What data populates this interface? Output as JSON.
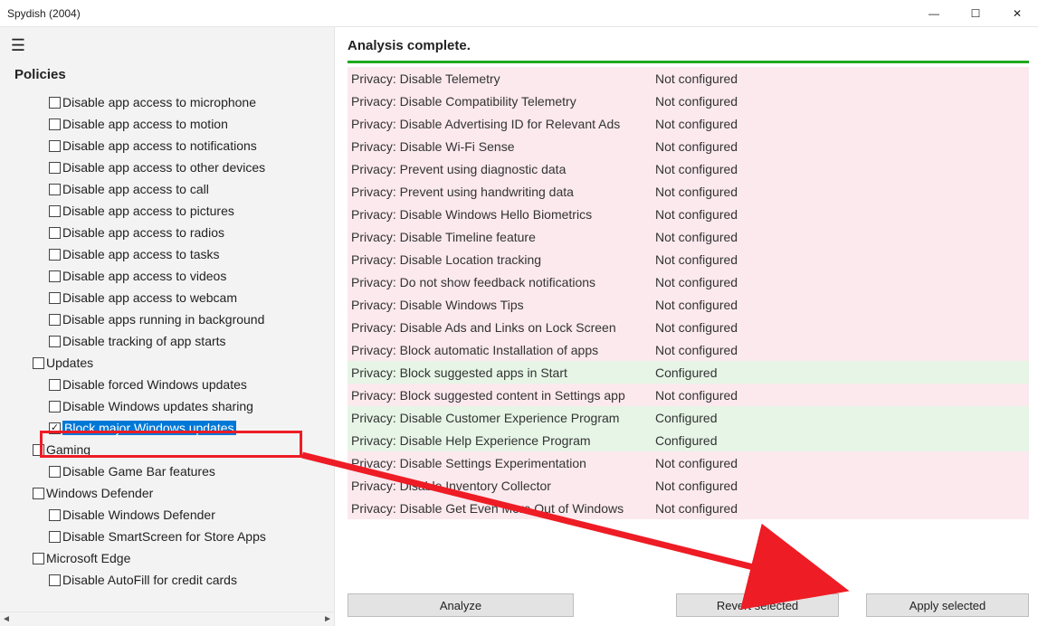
{
  "window": {
    "title": "Spydish (2004)"
  },
  "sidebar": {
    "title": "Policies",
    "items": [
      {
        "type": "item",
        "label": "Disable app access to microphone",
        "checked": false
      },
      {
        "type": "item",
        "label": "Disable app access to motion",
        "checked": false
      },
      {
        "type": "item",
        "label": "Disable app access to notifications",
        "checked": false
      },
      {
        "type": "item",
        "label": "Disable app access to other devices",
        "checked": false
      },
      {
        "type": "item",
        "label": "Disable app access to call",
        "checked": false
      },
      {
        "type": "item",
        "label": "Disable app access to pictures",
        "checked": false
      },
      {
        "type": "item",
        "label": "Disable app access to radios",
        "checked": false
      },
      {
        "type": "item",
        "label": "Disable app access to tasks",
        "checked": false
      },
      {
        "type": "item",
        "label": "Disable app access to videos",
        "checked": false
      },
      {
        "type": "item",
        "label": "Disable app access to webcam",
        "checked": false
      },
      {
        "type": "item",
        "label": "Disable apps running in background",
        "checked": false
      },
      {
        "type": "item",
        "label": "Disable tracking of app starts",
        "checked": false
      },
      {
        "type": "group",
        "label": "Updates",
        "checked": false
      },
      {
        "type": "item",
        "label": "Disable forced Windows updates",
        "checked": false
      },
      {
        "type": "item",
        "label": "Disable Windows updates sharing",
        "checked": false
      },
      {
        "type": "item",
        "label": "Block major Windows updates",
        "checked": true,
        "selected": true
      },
      {
        "type": "group",
        "label": "Gaming",
        "checked": false
      },
      {
        "type": "item",
        "label": "Disable Game Bar features",
        "checked": false
      },
      {
        "type": "group",
        "label": "Windows Defender",
        "checked": false
      },
      {
        "type": "item",
        "label": "Disable Windows Defender",
        "checked": false
      },
      {
        "type": "item",
        "label": "Disable SmartScreen for Store Apps",
        "checked": false
      },
      {
        "type": "group",
        "label": "Microsoft Edge",
        "checked": false
      },
      {
        "type": "item",
        "label": "Disable AutoFill for credit cards",
        "checked": false
      }
    ]
  },
  "analysis": {
    "header": "Analysis complete.",
    "status_not_configured": "Not configured",
    "status_configured": "Configured",
    "rows": [
      {
        "name": "Privacy: Disable Telemetry",
        "status": "nc"
      },
      {
        "name": "Privacy: Disable Compatibility Telemetry",
        "status": "nc"
      },
      {
        "name": "Privacy: Disable Advertising ID for Relevant Ads",
        "status": "nc"
      },
      {
        "name": "Privacy: Disable Wi-Fi Sense",
        "status": "nc"
      },
      {
        "name": "Privacy: Prevent using diagnostic data",
        "status": "nc"
      },
      {
        "name": "Privacy: Prevent using handwriting data",
        "status": "nc"
      },
      {
        "name": "Privacy: Disable Windows Hello Biometrics",
        "status": "nc"
      },
      {
        "name": "Privacy: Disable Timeline feature",
        "status": "nc"
      },
      {
        "name": "Privacy: Disable Location tracking",
        "status": "nc"
      },
      {
        "name": "Privacy: Do not show feedback notifications",
        "status": "nc"
      },
      {
        "name": "Privacy: Disable Windows Tips",
        "status": "nc"
      },
      {
        "name": "Privacy: Disable Ads and Links on Lock Screen",
        "status": "nc"
      },
      {
        "name": "Privacy: Block automatic Installation of apps",
        "status": "nc"
      },
      {
        "name": "Privacy: Block suggested apps in Start",
        "status": "cf"
      },
      {
        "name": "Privacy: Block suggested content in Settings app",
        "status": "nc"
      },
      {
        "name": "Privacy: Disable Customer Experience Program",
        "status": "cf"
      },
      {
        "name": "Privacy: Disable Help Experience Program",
        "status": "cf"
      },
      {
        "name": "Privacy: Disable Settings Experimentation",
        "status": "nc"
      },
      {
        "name": "Privacy: Disable Inventory Collector",
        "status": "nc"
      },
      {
        "name": "Privacy: Disable Get Even More Out of Windows",
        "status": "nc"
      }
    ]
  },
  "buttons": {
    "analyze": "Analyze",
    "revert": "Revert selected",
    "apply": "Apply selected"
  }
}
